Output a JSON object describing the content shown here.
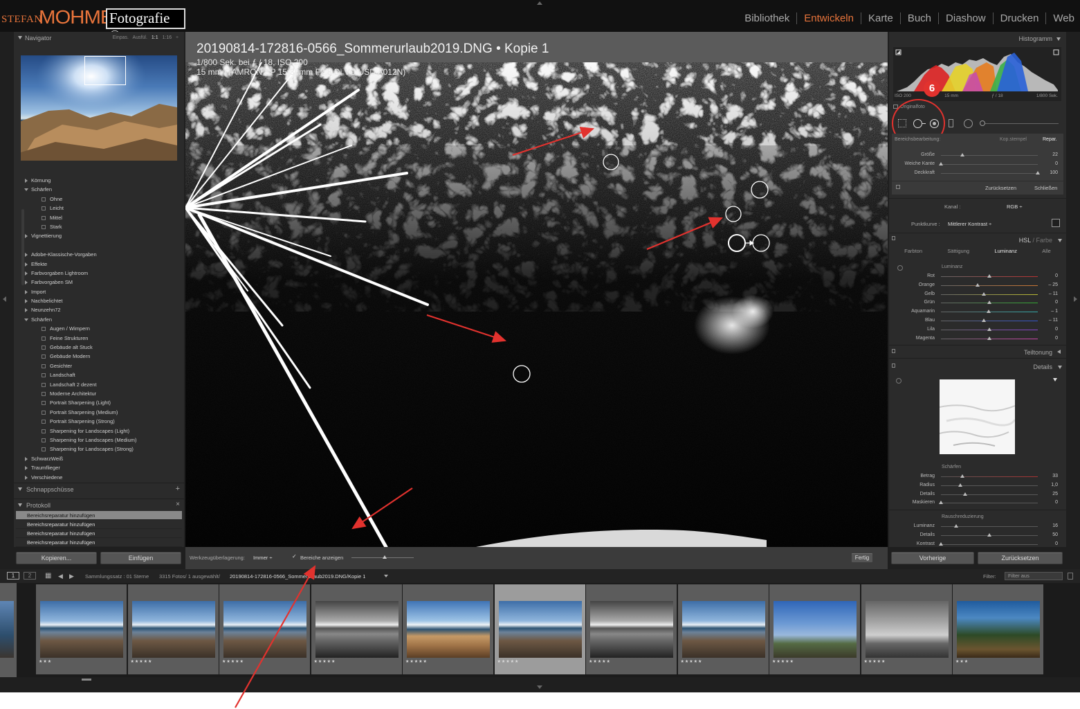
{
  "topbar": {
    "logo_stefan": "STEFAN",
    "logo_mohme": "MOHME",
    "logo_fotografie": "Fotografie ©",
    "modules": [
      {
        "label": "Bibliothek",
        "active": false
      },
      {
        "label": "Entwickeln",
        "active": true
      },
      {
        "label": "Karte",
        "active": false
      },
      {
        "label": "Buch",
        "active": false
      },
      {
        "label": "Diashow",
        "active": false
      },
      {
        "label": "Drucken",
        "active": false
      },
      {
        "label": "Web",
        "active": false
      }
    ],
    "accent_color": "#e8743b"
  },
  "navigator": {
    "title": "Navigator",
    "zoom_options": [
      "Einpas.",
      "Ausfül.",
      "1:1",
      "1:16 ÷"
    ]
  },
  "presets": {
    "items": [
      {
        "label": "Körnung",
        "level": 0,
        "type": "folder",
        "open": false
      },
      {
        "label": "Schärfen",
        "level": 0,
        "type": "folder",
        "open": true
      },
      {
        "label": "Ohne",
        "level": 1,
        "type": "preset"
      },
      {
        "label": "Leicht",
        "level": 1,
        "type": "preset"
      },
      {
        "label": "Mittel",
        "level": 1,
        "type": "preset"
      },
      {
        "label": "Stark",
        "level": 1,
        "type": "preset"
      },
      {
        "label": "Vignettierung",
        "level": 0,
        "type": "folder",
        "open": false
      },
      {
        "label": "",
        "level": 0,
        "type": "spacer"
      },
      {
        "label": "Adobe-Klassische-Vorgaben",
        "level": 0,
        "type": "folder",
        "open": false
      },
      {
        "label": "Effekte",
        "level": 0,
        "type": "folder",
        "open": false
      },
      {
        "label": "Farbvorgaben Lightroom",
        "level": 0,
        "type": "folder",
        "open": false
      },
      {
        "label": "Farbvorgaben SM",
        "level": 0,
        "type": "folder",
        "open": false
      },
      {
        "label": "Import",
        "level": 0,
        "type": "folder",
        "open": false
      },
      {
        "label": "Nachbelichtet",
        "level": 0,
        "type": "folder",
        "open": false
      },
      {
        "label": "Neunzehn72",
        "level": 0,
        "type": "folder",
        "open": false
      },
      {
        "label": "Schärfen",
        "level": 0,
        "type": "folder",
        "open": true
      },
      {
        "label": "Augen / Wimpern",
        "level": 1,
        "type": "preset"
      },
      {
        "label": "Feine Strukturen",
        "level": 1,
        "type": "preset"
      },
      {
        "label": "Gebäude alt Stuck",
        "level": 1,
        "type": "preset"
      },
      {
        "label": "Gebäude Modern",
        "level": 1,
        "type": "preset"
      },
      {
        "label": "Gesichter",
        "level": 1,
        "type": "preset"
      },
      {
        "label": "Landschaft",
        "level": 1,
        "type": "preset"
      },
      {
        "label": "Landschaft 2 dezent",
        "level": 1,
        "type": "preset"
      },
      {
        "label": "Moderne Architektur",
        "level": 1,
        "type": "preset"
      },
      {
        "label": "Portrait Sharpening (Light)",
        "level": 1,
        "type": "preset"
      },
      {
        "label": "Portrait Sharpening (Medium)",
        "level": 1,
        "type": "preset"
      },
      {
        "label": "Portrait Sharpening (Strong)",
        "level": 1,
        "type": "preset"
      },
      {
        "label": "Sharpening for Landscapes (Light)",
        "level": 1,
        "type": "preset"
      },
      {
        "label": "Sharpening for Landscapes (Medium)",
        "level": 1,
        "type": "preset"
      },
      {
        "label": "Sharpening for Landscapes (Strong)",
        "level": 1,
        "type": "preset"
      },
      {
        "label": "SchwarzWeiß",
        "level": 0,
        "type": "folder",
        "open": false
      },
      {
        "label": "Traumflieger",
        "level": 0,
        "type": "folder",
        "open": false
      },
      {
        "label": "Verschiedene",
        "level": 0,
        "type": "folder",
        "open": false
      }
    ]
  },
  "snapshots": {
    "title": "Schnappschüsse",
    "add": "+"
  },
  "history": {
    "title": "Protokoll",
    "close": "×",
    "items": [
      {
        "label": "Bereichsreparatur hinzufügen",
        "selected": true
      },
      {
        "label": "Bereichsreparatur hinzufügen",
        "selected": false
      },
      {
        "label": "Bereichsreparatur hinzufügen",
        "selected": false
      },
      {
        "label": "Bereichsreparatur hinzufügen",
        "selected": false
      }
    ]
  },
  "left_buttons": {
    "copy": "Kopieren...",
    "paste": "Einfügen"
  },
  "photo": {
    "title": "20190814-172816-0566_Sommerurlaub2019.DNG  •  Kopie 1",
    "line2": "1/800 Sek. bei ƒ / 18, ISO 200",
    "line3": "15 mm (TAMRON SP 15-30mm F2.8 Di VC USD A012N)"
  },
  "toolbar": {
    "overlay_label": "Werkzeugüberlagerung:",
    "overlay_value": "Immer ÷",
    "show_areas_label": "Bereiche anzeigen",
    "show_areas_checked": true,
    "done": "Fertig"
  },
  "histogram": {
    "title": "Histogramm",
    "meta": [
      "ISO 200",
      "15 mm",
      "ƒ / 18",
      "1/800 Sek."
    ],
    "original_label": "Originalfoto"
  },
  "annotation": {
    "number": "6"
  },
  "spot_removal": {
    "label": "Bereichsbearbeitung:",
    "clone": "Kop.stempel",
    "heal": "Repar.",
    "sliders": [
      {
        "label": "Größe",
        "value": "22",
        "pos": 0.22
      },
      {
        "label": "Weiche Kante",
        "value": "0",
        "pos": 0.0
      },
      {
        "label": "Deckkraft",
        "value": "100",
        "pos": 1.0
      }
    ],
    "reset": "Zurücksetzen",
    "close": "Schließen"
  },
  "tone_curve": {
    "channel_label": "Kanal :",
    "channel_value": "RGB ÷",
    "curve_label": "Punktkurve :",
    "curve_value": "Mittlerer Kontrast ÷"
  },
  "hsl": {
    "title_a": "HSL",
    "title_sep": " / ",
    "title_b": "Farbe",
    "tabs": [
      {
        "label": "Farbton",
        "active": false
      },
      {
        "label": "Sättigung",
        "active": false
      },
      {
        "label": "Luminanz",
        "active": true
      },
      {
        "label": "Alle",
        "active": false
      }
    ],
    "section": "Luminanz",
    "sliders": [
      {
        "label": "Rot",
        "value": "0",
        "pos": 0.5
      },
      {
        "label": "Orange",
        "value": "– 25",
        "pos": 0.375
      },
      {
        "label": "Gelb",
        "value": "– 11",
        "pos": 0.445
      },
      {
        "label": "Grün",
        "value": "0",
        "pos": 0.5
      },
      {
        "label": "Aquamarin",
        "value": "– 1",
        "pos": 0.495
      },
      {
        "label": "Blau",
        "value": "– 11",
        "pos": 0.445
      },
      {
        "label": "Lila",
        "value": "0",
        "pos": 0.5
      },
      {
        "label": "Magenta",
        "value": "0",
        "pos": 0.5
      }
    ]
  },
  "split_toning": {
    "title": "Teiltonung"
  },
  "details": {
    "title": "Details",
    "sharpen_title": "Schärfen",
    "sharpen": [
      {
        "label": "Betrag",
        "value": "33",
        "pos": 0.22
      },
      {
        "label": "Radius",
        "value": "1,0",
        "pos": 0.2
      },
      {
        "label": "Details",
        "value": "25",
        "pos": 0.25
      },
      {
        "label": "Maskieren",
        "value": "0",
        "pos": 0.0
      }
    ],
    "noise_title": "Rauschreduzierung",
    "noise": [
      {
        "label": "Luminanz",
        "value": "16",
        "pos": 0.16
      },
      {
        "label": "Details",
        "value": "50",
        "pos": 0.5
      },
      {
        "label": "Kontrast",
        "value": "0",
        "pos": 0.0
      }
    ]
  },
  "right_buttons": {
    "previous": "Vorherige",
    "reset": "Zurücksetzen"
  },
  "filmstrip_bar": {
    "pages": [
      "1",
      "2"
    ],
    "set_label": "Sammlungssatz : 01 Sterne",
    "count": "3315 Fotos/ 1 ausgewählt/",
    "file": "20190814-172816-0566_Sommerurlaub2019.DNG/Kopie 1",
    "filter_label": "Filter:",
    "filter_value": "Filter aus"
  },
  "filmstrip": [
    {
      "stars": "★★★",
      "style": "coast",
      "selected": false
    },
    {
      "stars": "★★★★★",
      "style": "coast",
      "selected": false
    },
    {
      "stars": "★★★★★",
      "style": "coast",
      "selected": false
    },
    {
      "stars": "★★★★★",
      "style": "bw",
      "selected": false
    },
    {
      "stars": "★★★★★",
      "style": "warm",
      "selected": false
    },
    {
      "stars": "★★★★★",
      "style": "coast",
      "selected": true
    },
    {
      "stars": "★★★★★",
      "style": "bw",
      "selected": false
    },
    {
      "stars": "★★★★★",
      "style": "coast",
      "selected": false
    },
    {
      "stars": "★★★★★",
      "style": "tree",
      "selected": false
    },
    {
      "stars": "★★★★★",
      "style": "treebw",
      "selected": false
    },
    {
      "stars": "★★★",
      "style": "forest",
      "selected": false
    }
  ]
}
